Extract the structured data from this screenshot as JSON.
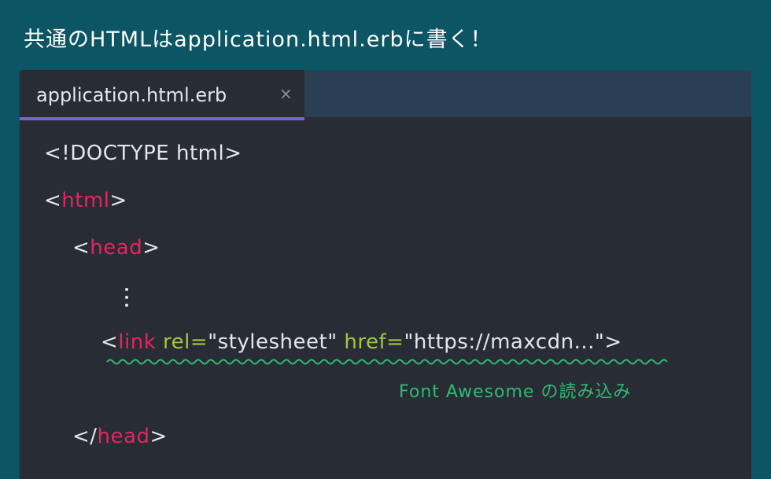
{
  "heading": "共通のHTMLはapplication.html.erbに書く！",
  "tab": {
    "label": "application.html.erb",
    "close_icon": "×"
  },
  "code": {
    "line1": "<!DOCTYPE html>",
    "line2": {
      "open": "<",
      "tag": "html",
      "close": ">"
    },
    "line3": {
      "open": "<",
      "tag": "head",
      "close": ">"
    },
    "ellipsis_icon": "vertical-ellipsis-icon",
    "line4": {
      "open": "<",
      "tag": "link",
      "attr1": " rel=",
      "val1": "\"stylesheet\"",
      "attr2": " href=",
      "val2": "\"https://maxcdn...\"",
      "close": ">"
    },
    "line5": {
      "open": "</",
      "tag": "head",
      "close": ">"
    }
  },
  "annotation": {
    "text": "Font Awesome の読み込み",
    "color": "#2fba73"
  },
  "colors": {
    "background": "#0b5564",
    "editor": "#282c34",
    "tabbar": "#2a3f52",
    "tab_underline": "#7a65c4",
    "tag": "#e8245f",
    "attr": "#9fc93a"
  }
}
